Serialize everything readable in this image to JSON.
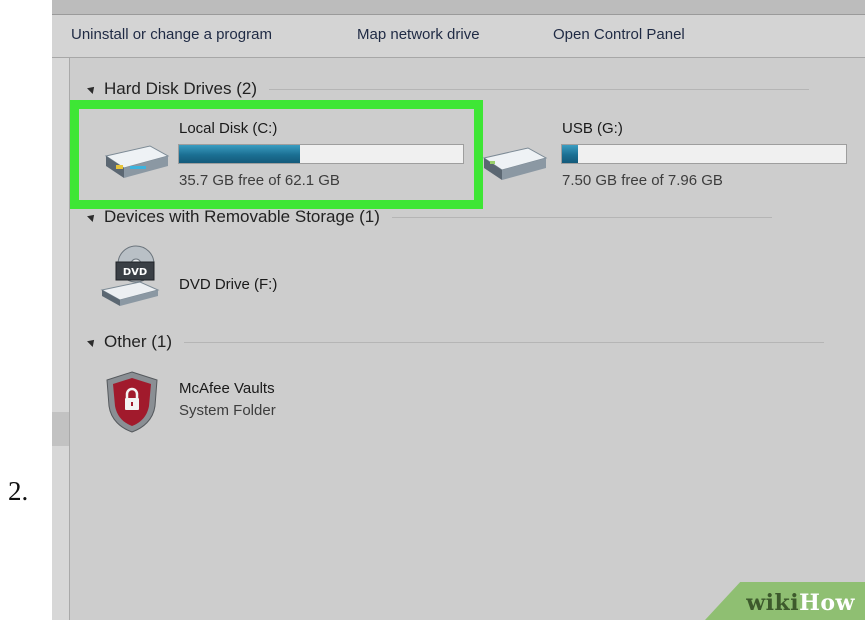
{
  "step": {
    "number": "2."
  },
  "toolbar": {
    "uninstall_label": "Uninstall or change a program",
    "map_drive_label": "Map network drive",
    "control_panel_label": "Open Control Panel"
  },
  "groups": {
    "hard_disks": {
      "title": "Hard Disk Drives (2)"
    },
    "removable": {
      "title": "Devices with Removable Storage (1)"
    },
    "other": {
      "title": "Other (1)"
    }
  },
  "drives": {
    "local": {
      "name": "Local Disk (C:)",
      "free_text": "35.7 GB free of 62.1 GB",
      "used_fraction": 0.425,
      "icon": "hard-drive-icon"
    },
    "usb": {
      "name": "USB (G:)",
      "free_text": "7.50 GB free of 7.96 GB",
      "used_fraction": 0.058,
      "icon": "usb-drive-icon"
    },
    "dvd": {
      "name": "DVD Drive (F:)",
      "icon": "dvd-drive-icon",
      "icon_text": "DVD"
    },
    "mcafee": {
      "name": "McAfee Vaults",
      "subtitle": "System Folder",
      "icon": "mcafee-shield-icon"
    }
  },
  "colors": {
    "highlight": "#3ee635",
    "bar_fill": "#1b6f93"
  },
  "watermark": {
    "part1": "wiki",
    "part2": "How"
  }
}
